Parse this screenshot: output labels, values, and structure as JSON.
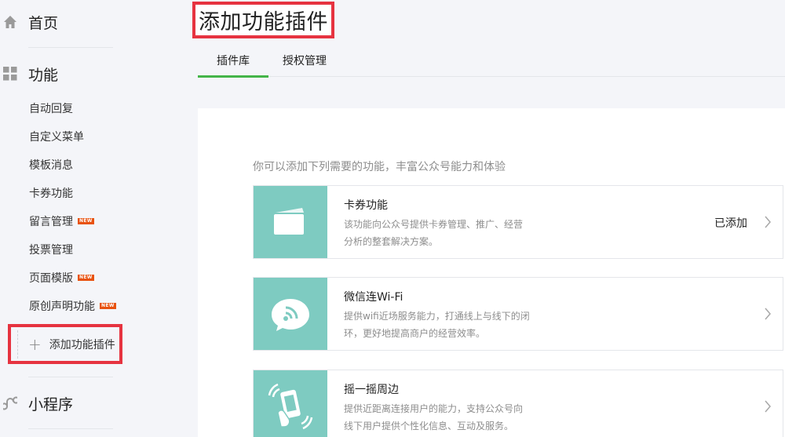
{
  "sidebar": {
    "home": {
      "label": "首页",
      "icon": "home-icon"
    },
    "functions": {
      "label": "功能",
      "icon": "grid-icon",
      "items": [
        {
          "label": "自动回复",
          "new": false
        },
        {
          "label": "自定义菜单",
          "new": false
        },
        {
          "label": "模板消息",
          "new": false
        },
        {
          "label": "卡券功能",
          "new": false
        },
        {
          "label": "留言管理",
          "new": true
        },
        {
          "label": "投票管理",
          "new": false
        },
        {
          "label": "页面模版",
          "new": true
        },
        {
          "label": "原创声明功能",
          "new": true
        }
      ],
      "new_badge": "NEW",
      "add_plugin": {
        "icon": "plus-icon",
        "label": "添加功能插件"
      }
    },
    "mini_program": {
      "label": "小程序",
      "icon": "mini-program-icon"
    }
  },
  "header": {
    "title": "添加功能插件",
    "tabs": [
      {
        "label": "插件库",
        "active": true
      },
      {
        "label": "授权管理",
        "active": false
      }
    ]
  },
  "main": {
    "intro": "你可以添加下列需要的功能，丰富公众号能力和体验",
    "plugins": [
      {
        "name": "卡券功能",
        "desc_line1": "该功能向公众号提供卡券管理、推广、经营",
        "desc_line2": "分析的整套解决方案。",
        "status": "已添加",
        "icon": "card-icon"
      },
      {
        "name": "微信连Wi-Fi",
        "desc_line1": "提供wifi近场服务能力，打通线上与线下的闭",
        "desc_line2": "环，更好地提高商户的经营效率。",
        "status": "",
        "icon": "wifi-icon"
      },
      {
        "name": "摇一摇周边",
        "desc_line1": "提供近距离连接用户的能力，支持公众号向",
        "desc_line2": "线下用户提供个性化信息、互动及服务。",
        "status": "",
        "icon": "shake-icon"
      }
    ]
  },
  "colors": {
    "accent_green": "#44b549",
    "highlight_red": "#e63340",
    "new_badge": "#e8520f",
    "thumb_teal": "#7ecbc1"
  }
}
